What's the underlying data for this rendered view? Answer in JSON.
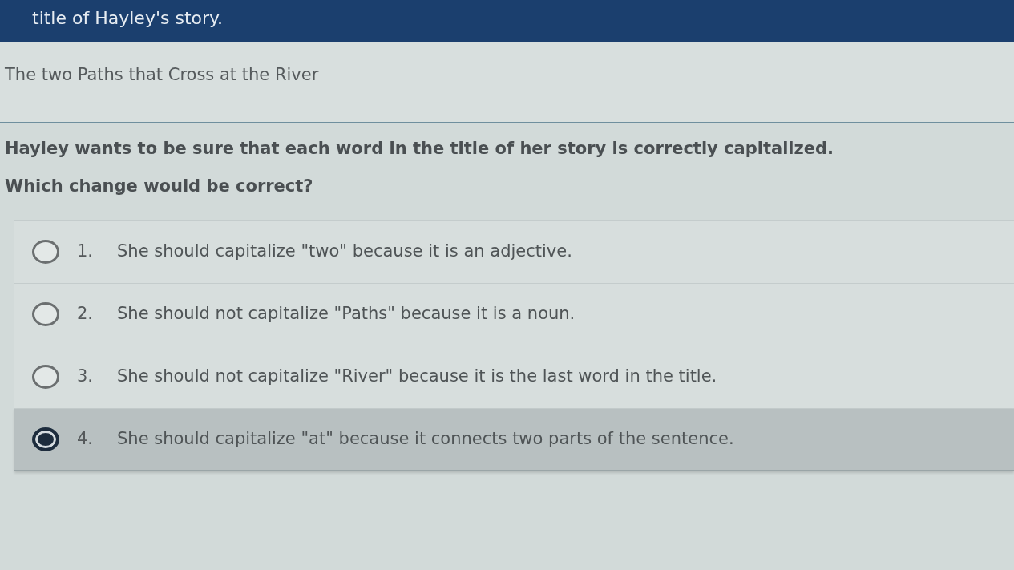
{
  "header": {
    "title": "title of Hayley's story."
  },
  "passage": {
    "title": "The two Paths that Cross at the River"
  },
  "question": {
    "prompt": "Hayley wants to be sure that each word in the title of her story is correctly capitalized.",
    "question": "Which change would be correct?"
  },
  "options": [
    {
      "number": "1.",
      "text": "She should capitalize \"two\" because it is an adjective.",
      "selected": false
    },
    {
      "number": "2.",
      "text": "She should not capitalize \"Paths\" because it is a noun.",
      "selected": false
    },
    {
      "number": "3.",
      "text": "She should not capitalize \"River\" because it is the last word in the title.",
      "selected": false
    },
    {
      "number": "4.",
      "text": "She should capitalize \"at\" because it connects two parts of the sentence.",
      "selected": true
    }
  ]
}
